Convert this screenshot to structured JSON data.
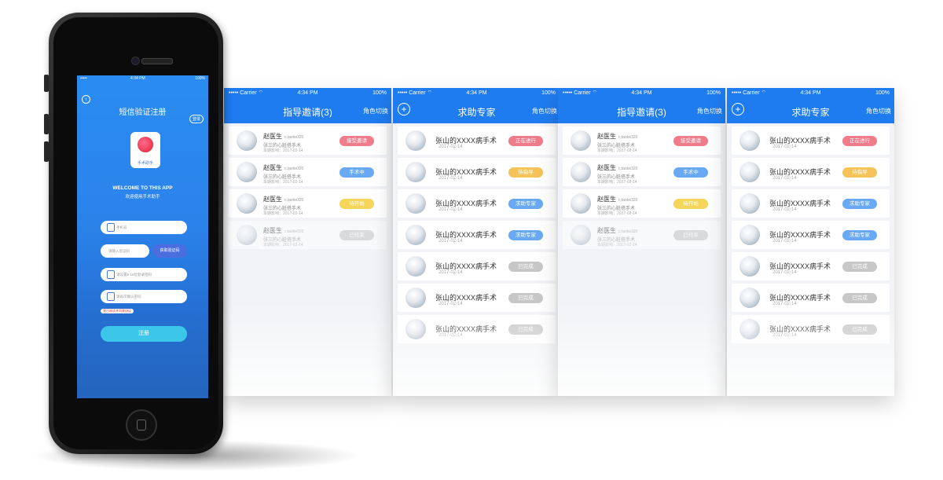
{
  "colors": {
    "primary": "#1f7cf0",
    "pink": "#f07b8a",
    "blue": "#69a8f2",
    "yellow": "#f5d55a",
    "gray": "#c7c7c7",
    "orange": "#f5c35a"
  },
  "panel_a": {
    "status_left": "••••• Carrier ⌔",
    "status_time": "4:34 PM",
    "status_right": "100%",
    "title": "指导邀请(3)",
    "right_action": "角色切换",
    "rows": [
      {
        "name": "赵医生",
        "tag": "c.taoke320",
        "sub": "张三的心脏搭手术",
        "sub2": "本期影响：2017-02-14",
        "badge": "接受邀请",
        "badge_color": "#f07b8a"
      },
      {
        "name": "赵医生",
        "tag": "c.taoke320",
        "sub": "张三的心脏搭手术",
        "sub2": "本期影响：2017-02-14",
        "badge": "手术中",
        "badge_color": "#69a8f2"
      },
      {
        "name": "赵医生",
        "tag": "c.taoke320",
        "sub": "张三的心脏搭手术",
        "sub2": "本期影响：2017-02-14",
        "badge": "待开始",
        "badge_color": "#f5d55a"
      },
      {
        "name": "赵医生",
        "tag": "c.taoke320",
        "sub": "张三的心脏搭手术",
        "sub2": "本期影响：2017-02-14",
        "badge": "已结束",
        "badge_color": "#c7c7c7"
      }
    ]
  },
  "panel_b": {
    "status_left": "••••• Carrier ⌔",
    "status_time": "4:34 PM",
    "status_right": "100%",
    "title": "求助专家",
    "right_action": "角色切换",
    "rows": [
      {
        "title": "张山的XXXX病手术",
        "date": "2017-02-14",
        "badge": "正在进行",
        "badge_color": "#f07b8a"
      },
      {
        "title": "张山的XXXX病手术",
        "date": "2017-02-14",
        "badge": "待指导",
        "badge_color": "#f5c35a"
      },
      {
        "title": "张山的XXXX病手术",
        "date": "2017-02-14",
        "badge": "求助专家",
        "badge_color": "#69a8f2"
      },
      {
        "title": "张山的XXXX病手术",
        "date": "2017-02-14",
        "badge": "求助专家",
        "badge_color": "#69a8f2"
      },
      {
        "title": "张山的XXXX病手术",
        "date": "2017-02-14",
        "badge": "已完成",
        "badge_color": "#c7c7c7"
      },
      {
        "title": "张山的XXXX病手术",
        "date": "2017-02-14",
        "badge": "已完成",
        "badge_color": "#c7c7c7"
      },
      {
        "title": "张山的XXXX病手术",
        "date": "2017-02-14",
        "badge": "已完成",
        "badge_color": "#c7c7c7"
      }
    ]
  },
  "phone": {
    "status_left": "•••••",
    "status_time": "4:34 PM",
    "status_right": "100%",
    "screen_title": "短信验证注册",
    "lang_button": "登录",
    "logo_text": "手术助手",
    "welcome": "WELCOME TO THIS APP",
    "welcome_sub": "欢迎使用手术助手",
    "phone_placeholder": "手机号",
    "code_placeholder": "请输入验证码",
    "code_button": "获取验证码",
    "password_placeholder": "请设置6-16位登录密码",
    "confirm_placeholder": "请再次确认密码",
    "agree_text": "我已阅读并同意协议",
    "register_button": "注册"
  }
}
